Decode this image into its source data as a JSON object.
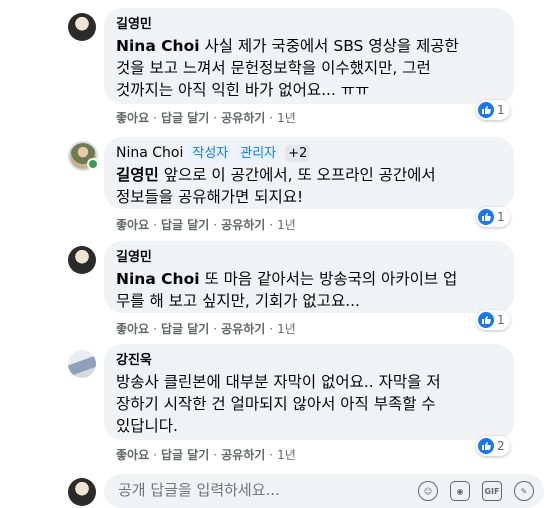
{
  "comments": [
    {
      "author": "길영민",
      "mention": "Nina Choi",
      "text_line1": " 사실 제가 국중에서 SBS 영상을 제공한",
      "text_line2": "것을 보고 느껴서 문헌정보학을 이수했지만, 그런",
      "text_line3": "것까지는 아직 익힌 바가 없어요... ㅠㅠ",
      "likes": "1"
    },
    {
      "author": "Nina Choi",
      "badges": [
        "작성자",
        "관리자",
        "+2"
      ],
      "mention": "길영민",
      "text_line1": " 앞으로 이 공간에서, 또 오프라인 공간에서",
      "text_line2": "정보들을 공유해가면 되지요!",
      "likes": "1"
    },
    {
      "author": "길영민",
      "mention": "Nina Choi",
      "text_line1": " 또 마음 같아서는 방송국의 아카이브 업",
      "text_line2": "무를 해 보고 싶지만, 기회가 없고요...",
      "likes": "1"
    },
    {
      "author": "강진욱",
      "text_line1": "방송사 클린본에 대부분 자막이 없어요.. 자막을 저",
      "text_line2": "장하기 시작한 건 얼마되지 않아서 아직 부족할 수",
      "text_line3": "있답니다.",
      "likes": "2"
    }
  ],
  "actions": {
    "like": "좋아요",
    "reply": "답글 달기",
    "share": "공유하기",
    "time": "1년",
    "sep": "·"
  },
  "composer": {
    "placeholder": "공개 답글을 입력하세요..."
  },
  "colors": {
    "bubble": "#f0f2f5",
    "accent": "#1877f2",
    "meta": "#65676b"
  }
}
